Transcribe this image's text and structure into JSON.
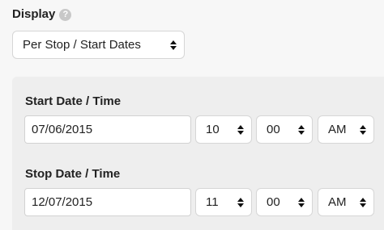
{
  "display": {
    "label": "Display",
    "help_icon": "question-mark-icon",
    "selected": "Per Stop / Start Dates"
  },
  "start": {
    "label": "Start Date / Time",
    "date": "07/06/2015",
    "hour": "10",
    "minute": "00",
    "ampm": "AM"
  },
  "stop": {
    "label": "Stop Date / Time",
    "date": "12/07/2015",
    "hour": "11",
    "minute": "00",
    "ampm": "AM"
  }
}
